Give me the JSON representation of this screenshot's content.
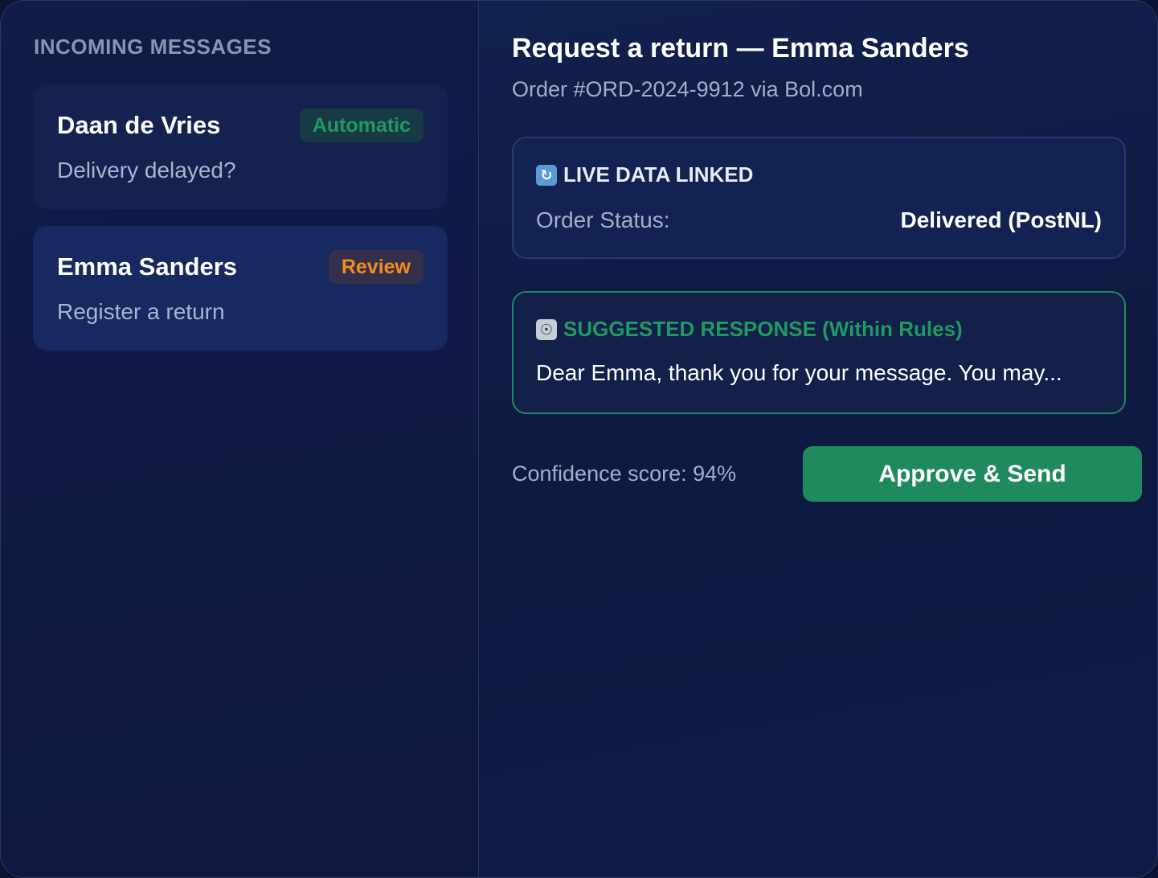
{
  "inbox": {
    "title": "INCOMING MESSAGES",
    "messages": [
      {
        "name": "Daan de Vries",
        "preview": "Delivery delayed?",
        "badge": "Automatic",
        "badge_color": "#1e9a62"
      },
      {
        "name": "Emma Sanders",
        "preview": "Register a return",
        "badge": "Review",
        "badge_color": "#f28c1c"
      }
    ]
  },
  "detail": {
    "title": "Request a return — Emma Sanders",
    "subtitle": "Order #ORD-2024-9912 via Bol.com",
    "live_data": {
      "icon": "sync-icon",
      "heading": "LIVE DATA LINKED",
      "status_label": "Order Status:",
      "status_value": "Delivered (PostNL)"
    },
    "suggestion": {
      "icon": "robot-icon",
      "heading": "SUGGESTED RESPONSE (Within Rules)",
      "text": "Dear Emma, thank you for your message. You may..."
    },
    "confidence": "Confidence score: 94%",
    "approve_label": "Approve & Send"
  },
  "colors": {
    "accent_green": "#1f8a5e",
    "review_orange": "#f28c1c",
    "background": "#0f1a42"
  }
}
